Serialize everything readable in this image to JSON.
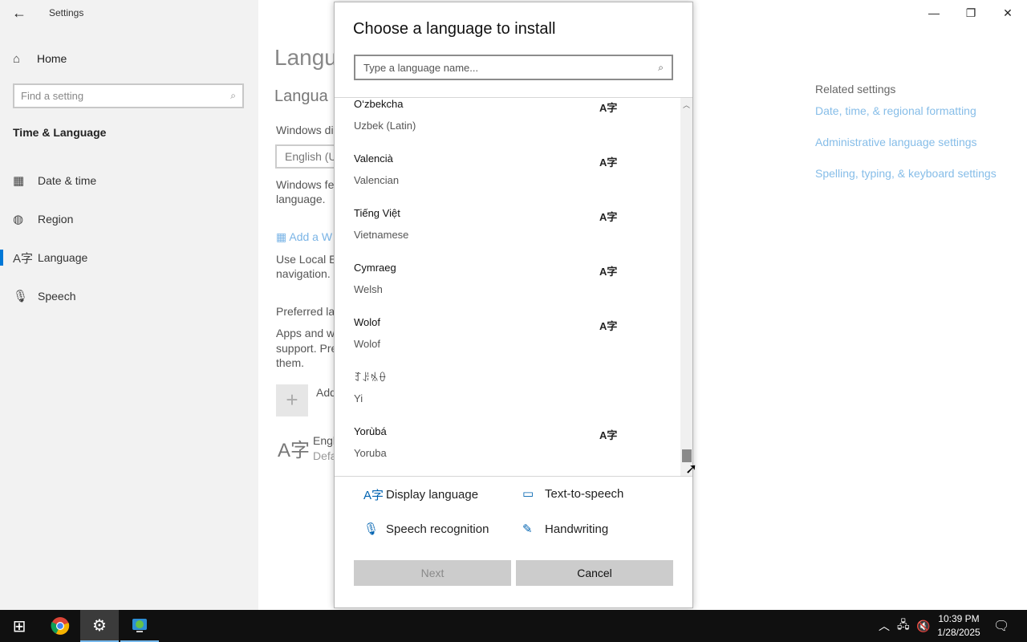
{
  "window": {
    "app_title": "Settings",
    "controls": {
      "minimize": "—",
      "maximize": "❐",
      "close": "✕"
    }
  },
  "sidebar": {
    "home_label": "Home",
    "search_placeholder": "Find a setting",
    "section_title": "Time & Language",
    "items": [
      {
        "label": "Date & time",
        "icon": "calendar-clock-icon"
      },
      {
        "label": "Region",
        "icon": "globe-icon"
      },
      {
        "label": "Language",
        "icon": "language-icon",
        "selected": true
      },
      {
        "label": "Speech",
        "icon": "microphone-icon"
      }
    ]
  },
  "background_page": {
    "heading": "Langu",
    "subheading": "Langua",
    "windows_display_label": "Windows di",
    "display_dropdown_value": "English (U",
    "windows_features_line1": "Windows fe",
    "windows_features_line2": "language.",
    "add_windows_link": "Add a W",
    "local_experience_line1": "Use Local Ex",
    "local_experience_line2": "navigation.",
    "preferred_heading": "Preferred la",
    "apps_line1": "Apps and w",
    "apps_line2": "support. Pre",
    "apps_line3": "them.",
    "add_label": "Add",
    "lang_entry_line1": "Engl",
    "lang_entry_line2": "Defa"
  },
  "related_settings": {
    "title": "Related settings",
    "links": [
      "Date, time, & regional formatting",
      "Administrative language settings",
      "Spelling, typing, & keyboard settings"
    ]
  },
  "dialog": {
    "title": "Choose a language to install",
    "search_placeholder": "Type a language name...",
    "languages": [
      {
        "native": "O‘zbekcha",
        "english": "Uzbek (Latin)",
        "display_language": true
      },
      {
        "native": "Valencià",
        "english": "Valencian",
        "display_language": true
      },
      {
        "native": "Tiếng Việt",
        "english": "Vietnamese",
        "display_language": true
      },
      {
        "native": "Cymraeg",
        "english": "Welsh",
        "display_language": true
      },
      {
        "native": "Wolof",
        "english": "Wolof",
        "display_language": true
      },
      {
        "native": "ꆈꌠꁱꂷ",
        "english": "Yi",
        "display_language": false
      },
      {
        "native": "Yorùbá",
        "english": "Yoruba",
        "display_language": true
      }
    ],
    "scroll_position_fraction": 0.97,
    "features": [
      {
        "label": "Display language",
        "icon": "display-language-icon",
        "glyph": "A字"
      },
      {
        "label": "Text-to-speech",
        "icon": "text-to-speech-icon",
        "glyph": "▭"
      },
      {
        "label": "Speech recognition",
        "icon": "microphone-icon",
        "glyph": "🎙"
      },
      {
        "label": "Handwriting",
        "icon": "handwriting-icon",
        "glyph": "✎"
      }
    ],
    "next_label": "Next",
    "cancel_label": "Cancel"
  },
  "taskbar": {
    "time": "10:39 PM",
    "date": "1/28/2025"
  }
}
